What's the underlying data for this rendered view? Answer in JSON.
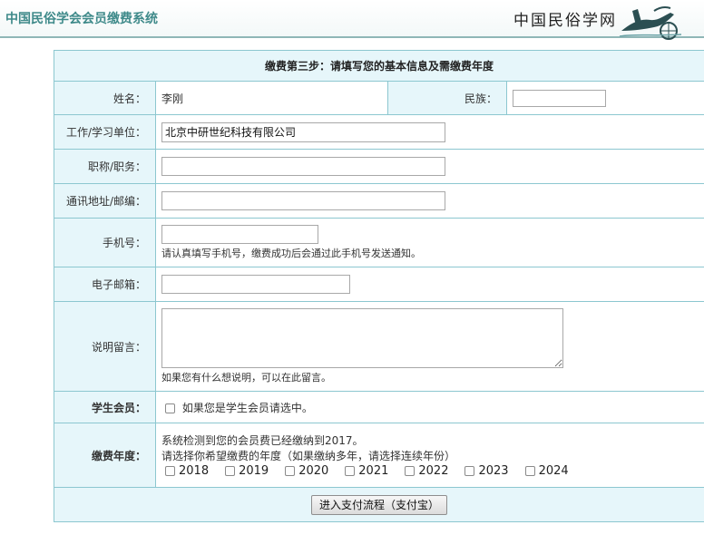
{
  "header": {
    "site_title": "中国民俗学会会员缴费系统",
    "logo_text": "中国民俗学网"
  },
  "form": {
    "step_title": "缴费第三步：请填写您的基本信息及需缴费年度",
    "name_label": "姓名：",
    "name_value": "李刚",
    "ethnicity_label": "民族：",
    "ethnicity_value": "",
    "workplace_label": "工作/学习单位：",
    "workplace_value": "北京中研世纪科技有限公司",
    "title_label": "职称/职务：",
    "title_value": "",
    "address_label": "通讯地址/邮编：",
    "address_value": "",
    "phone_label": "手机号：",
    "phone_value": "",
    "phone_hint": "请认真填写手机号，缴费成功后会通过此手机号发送通知。",
    "email_label": "电子邮箱：",
    "email_value": "",
    "message_label": "说明留言：",
    "message_value": "",
    "message_hint": "如果您有什么想说明，可以在此留言。",
    "student_label": "学生会员：",
    "student_checkbox_label": "如果您是学生会员请选中。",
    "student_checked": false,
    "year_label": "缴费年度：",
    "year_detected": "系统检测到您的会员费已经缴纳到2017。",
    "year_instruction": "请选择你希望缴费的年度（如果缴纳多年，请选择连续年份）",
    "years": [
      "2018",
      "2019",
      "2020",
      "2021",
      "2022",
      "2023",
      "2024"
    ],
    "submit_label": "进入支付流程（支付宝）"
  }
}
